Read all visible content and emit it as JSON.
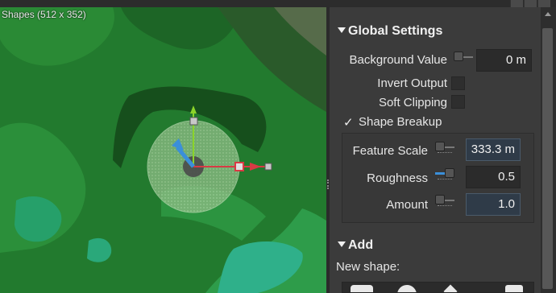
{
  "viewport": {
    "title": "Shapes (512 x 352)"
  },
  "panel": {
    "global_settings": {
      "header": "Global Settings",
      "background_value": {
        "label": "Background Value",
        "value": "0 m"
      },
      "invert_output": {
        "label": "Invert Output",
        "checked": false
      },
      "soft_clipping": {
        "label": "Soft Clipping",
        "checked": false
      },
      "shape_breakup": {
        "label": "Shape Breakup",
        "checked": true,
        "check_glyph": "✓",
        "feature_scale": {
          "label": "Feature Scale",
          "value": "333.3 m"
        },
        "roughness": {
          "label": "Roughness",
          "value": "0.5"
        },
        "amount": {
          "label": "Amount",
          "value": "1.0"
        }
      }
    },
    "add": {
      "header": "Add",
      "new_shape_label": "New shape:"
    }
  },
  "colors": {
    "accent_blue": "#3b8fd9",
    "panel_bg": "#3b3b3b",
    "terrain_green": "#1f6b29",
    "gizmo_red": "#d83a44",
    "gizmo_green": "#8bd42a"
  }
}
